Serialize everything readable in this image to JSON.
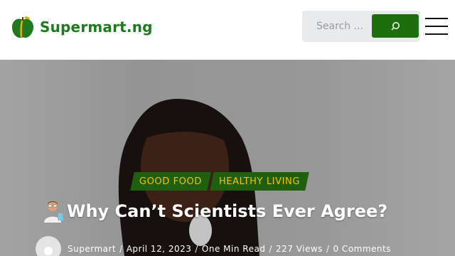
{
  "header": {
    "logo_text": "Supermart.ng",
    "brand_color": "#1f7a1f",
    "search": {
      "placeholder": "Search ..."
    }
  },
  "hero": {
    "categories": [
      "GOOD FOOD",
      "HEALTHY LIVING"
    ],
    "title": "Why Can’t Scientists Ever Agree?",
    "meta": {
      "author": "Supermart",
      "date": "April 12, 2023",
      "read_time": "One Min Read",
      "views": "227 Views",
      "comments": "0 Comments"
    }
  },
  "colors": {
    "button": "#1d6f0d",
    "category_bg": "#1f5f0e",
    "category_text": "#f2c200"
  }
}
